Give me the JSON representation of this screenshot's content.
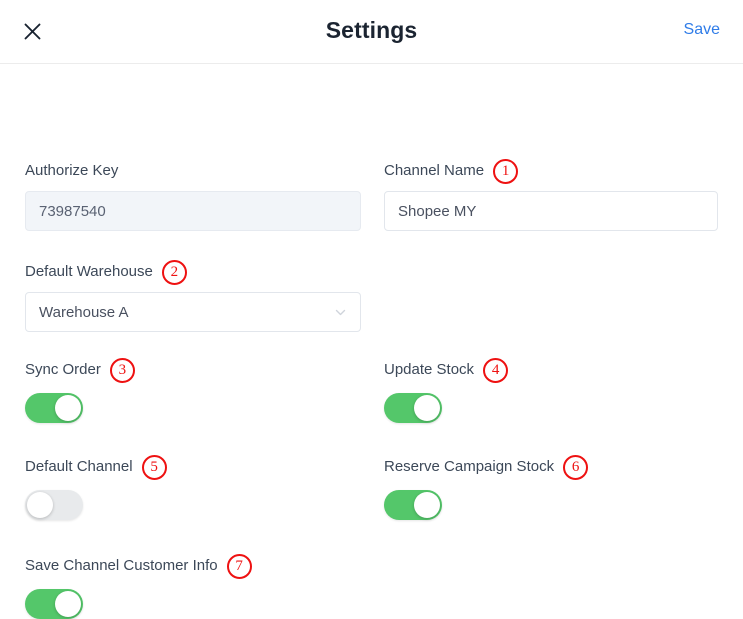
{
  "header": {
    "close_icon": "close-icon",
    "title": "Settings",
    "save_label": "Save",
    "save_color": "#2f7ce8"
  },
  "marker_color": "#ee1111",
  "toggle_on_color": "#54c76a",
  "toggle_off_color": "#e8eaec",
  "fields": {
    "authorize_key": {
      "label": "Authorize Key",
      "value": "73987540",
      "marker": ""
    },
    "channel_name": {
      "label": "Channel Name",
      "value": "Shopee MY",
      "marker": "1"
    },
    "default_warehouse": {
      "label": "Default Warehouse",
      "value": "Warehouse A",
      "marker": "2"
    },
    "sync_order": {
      "label": "Sync Order",
      "marker": "3",
      "state": "on"
    },
    "update_stock": {
      "label": "Update Stock",
      "marker": "4",
      "state": "on"
    },
    "default_channel": {
      "label": "Default Channel",
      "marker": "5",
      "state": "off"
    },
    "reserve_campaign_stock": {
      "label": "Reserve Campaign Stock",
      "marker": "6",
      "state": "on"
    },
    "save_channel_customer_info": {
      "label": "Save Channel Customer Info",
      "marker": "7",
      "state": "on"
    }
  }
}
